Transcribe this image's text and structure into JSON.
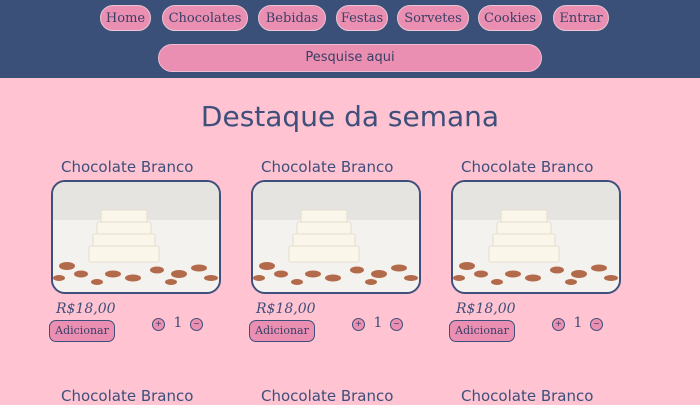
{
  "nav": {
    "items": [
      "Home",
      "Chocolates",
      "Bebidas",
      "Festas",
      "Sorvetes",
      "Cookies",
      "Entrar"
    ]
  },
  "search": {
    "placeholder": "Pesquise aqui"
  },
  "main": {
    "title": "Destaque da semana",
    "products": [
      {
        "name": "Chocolate Branco",
        "price": "R$18,00",
        "add_label": "Adicionar",
        "quantity": "1",
        "image_icon": "white-chocolate-almonds-image"
      },
      {
        "name": "Chocolate Branco",
        "price": "R$18,00",
        "add_label": "Adicionar",
        "quantity": "1",
        "image_icon": "white-chocolate-almonds-image"
      },
      {
        "name": "Chocolate Branco",
        "price": "R$18,00",
        "add_label": "Adicionar",
        "quantity": "1",
        "image_icon": "white-chocolate-almonds-image"
      }
    ],
    "next_row": [
      {
        "name": "Chocolate Branco"
      },
      {
        "name": "Chocolate Branco"
      },
      {
        "name": "Chocolate Branco"
      }
    ]
  },
  "controls": {
    "plus": "+",
    "minus": "−"
  },
  "colors": {
    "header_bg": "#3b5078",
    "page_bg": "#ffc3d1",
    "button_pink": "#ea8fb1",
    "text_navy": "#3d4f7a"
  }
}
